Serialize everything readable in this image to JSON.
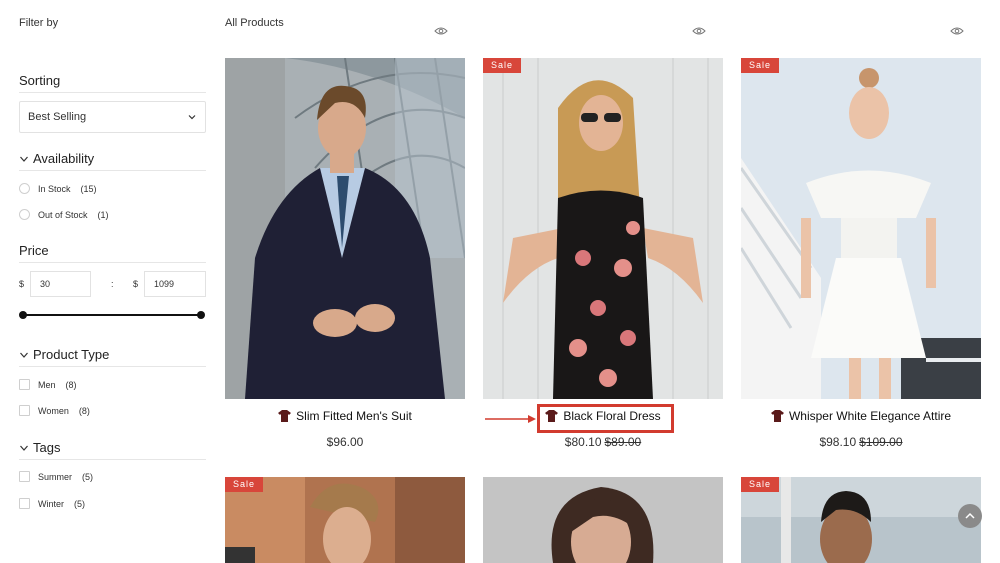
{
  "sidebar": {
    "filter_by": "Filter by",
    "sorting": {
      "title": "Sorting",
      "selected": "Best Selling"
    },
    "availability": {
      "title": "Availability",
      "options": [
        {
          "label": "In Stock",
          "count": "(15)"
        },
        {
          "label": "Out of Stock",
          "count": "(1)"
        }
      ]
    },
    "price": {
      "title": "Price",
      "currency": "$",
      "separator": ":",
      "min": "30",
      "max": "1099"
    },
    "product_type": {
      "title": "Product Type",
      "options": [
        {
          "label": "Men",
          "count": "(8)"
        },
        {
          "label": "Women",
          "count": "(8)"
        }
      ]
    },
    "tags": {
      "title": "Tags",
      "options": [
        {
          "label": "Summer",
          "count": "(5)"
        },
        {
          "label": "Winter",
          "count": "(5)"
        }
      ]
    }
  },
  "main": {
    "heading": "All Products",
    "sale_badge": "Sale",
    "products": [
      {
        "name": "Slim Fitted Men's Suit",
        "price": "$96.00",
        "old_price": ""
      },
      {
        "name": "Black Floral Dress",
        "price": "$80.10",
        "old_price": "$89.00"
      },
      {
        "name": "Whisper White Elegance Attire",
        "price": "$98.10",
        "old_price": "$109.00"
      }
    ]
  },
  "colors": {
    "sale": "#d8463a",
    "highlight": "#d23b2f",
    "icon": "#5a1a1a"
  }
}
